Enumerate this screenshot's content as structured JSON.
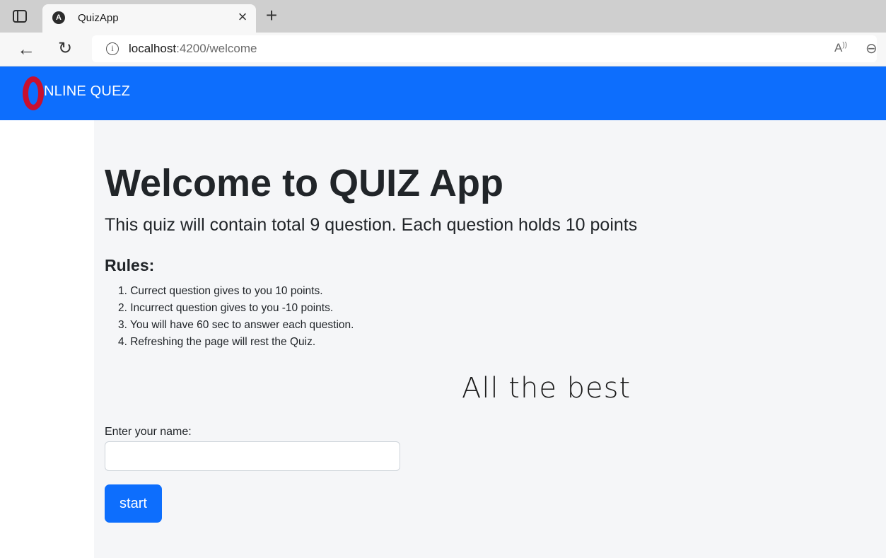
{
  "browser": {
    "tab_title": "QuizApp",
    "tab_favicon": "A",
    "url_host": "localhost",
    "url_rest": ":4200/welcome",
    "icons": [
      "tab-actions-icon",
      "angular-favicon-icon",
      "close-icon",
      "plus-icon",
      "back-arrow-icon",
      "refresh-icon",
      "info-icon",
      "read-aloud-icon",
      "zoom-out-icon"
    ],
    "back_glyph": "←",
    "refresh_glyph": "↻",
    "close_glyph": "×",
    "new_tab_glyph": "+",
    "info_glyph": "i",
    "read_aloud_glyph": "A",
    "zoom_glyph": "⊖"
  },
  "navbar": {
    "brand": "NLINE QUEZ",
    "logo_icon": "opera-o-logo",
    "background": "#0d6efd",
    "logo_color": "#c8102e"
  },
  "main": {
    "title": "Welcome to QUIZ App",
    "lead": "This quiz will contain total 9 question. Each question holds 10 points",
    "rules_heading": "Rules:",
    "rules": [
      "1. Currect question gives to you 10 points.",
      "2. Incurrect question gives to you -10 points.",
      "3. You will have 60 sec to answer each question.",
      "4. Refreshing the page will rest the Quiz."
    ],
    "best_wishes": "All the best",
    "name_label": "Enter your name:",
    "name_value": "",
    "start_label": "start",
    "accent": "#0d6efd"
  }
}
